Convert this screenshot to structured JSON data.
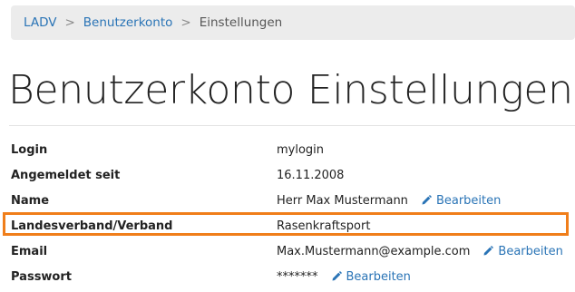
{
  "breadcrumb": {
    "items": [
      "LADV",
      "Benutzerkonto",
      "Einstellungen"
    ],
    "separator": ">"
  },
  "page": {
    "title": "Benutzerkonto Einstellungen"
  },
  "colors": {
    "link": "#2a74b6",
    "highlight": "#f07e1a"
  },
  "details": {
    "edit_label": "Bearbeiten",
    "rows": [
      {
        "label": "Login",
        "value": "mylogin"
      },
      {
        "label": "Angemeldet seit",
        "value": "16.11.2008"
      },
      {
        "label": "Name",
        "value": "Herr Max Mustermann"
      },
      {
        "label": "Landesverband/Verband",
        "value": "Rasenkraftsport"
      },
      {
        "label": "Email",
        "value": "Max.Mustermann@example.com"
      },
      {
        "label": "Passwort",
        "value": "*******"
      }
    ]
  },
  "icons": {
    "edit": "pencil-icon"
  }
}
